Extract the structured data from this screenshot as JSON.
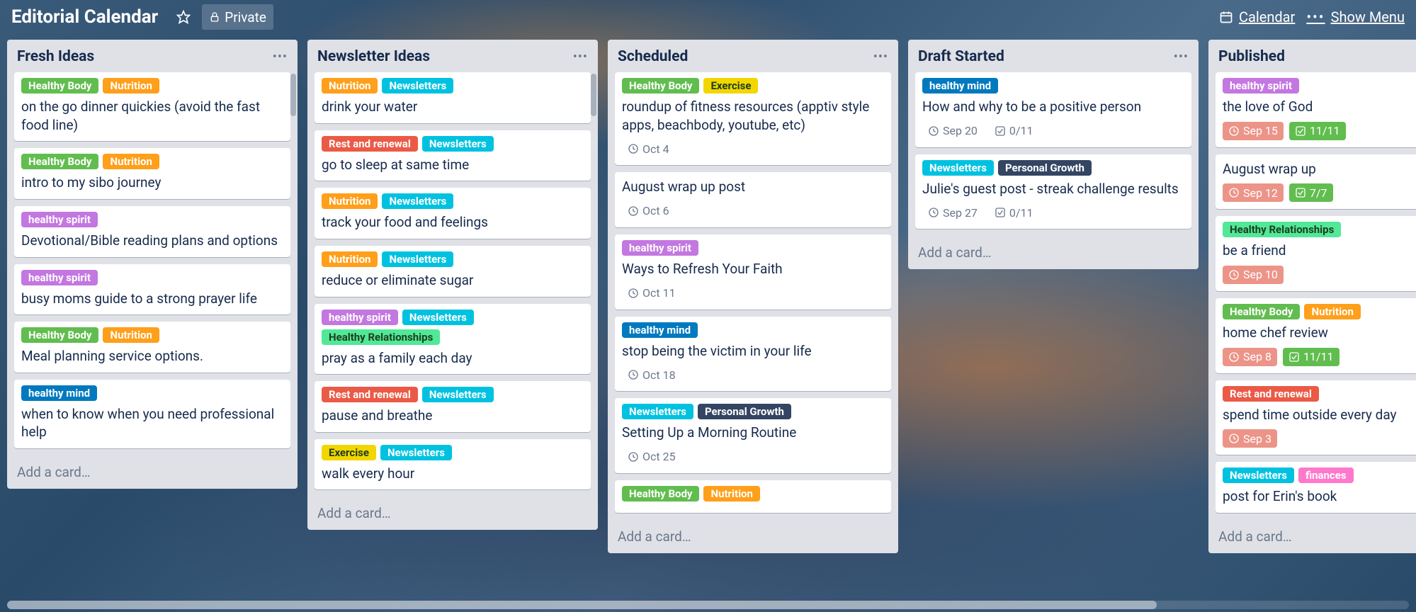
{
  "colors": {
    "green": "#61bd4f",
    "orange": "#ff9f1a",
    "yellow": "#f2d600",
    "purple": "#c377e0",
    "blue": "#0079bf",
    "aqua": "#00c2e0",
    "red": "#eb5a46",
    "lime": "#51e898",
    "pink": "#ff78cb",
    "black": "#344563",
    "date_past": "#ec9488",
    "checklist_done": "#61bd4f"
  },
  "header": {
    "title": "Editorial Calendar",
    "privacy": "Private",
    "calendar": "Calendar",
    "show_menu": "Show Menu"
  },
  "add_card_text": "Add a card…",
  "lists": [
    {
      "title": "Fresh Ideas",
      "show_menu": true,
      "scroll_hint": true,
      "cards": [
        {
          "labels": [
            {
              "text": "Healthy Body",
              "color": "green"
            },
            {
              "text": "Nutrition",
              "color": "orange"
            }
          ],
          "title": "on the go dinner quickies (avoid the fast food line)"
        },
        {
          "labels": [
            {
              "text": "Healthy Body",
              "color": "green"
            },
            {
              "text": "Nutrition",
              "color": "orange"
            }
          ],
          "title": "intro to my sibo journey"
        },
        {
          "labels": [
            {
              "text": "healthy spirit",
              "color": "purple"
            }
          ],
          "title": "Devotional/Bible reading plans and options"
        },
        {
          "labels": [
            {
              "text": "healthy spirit",
              "color": "purple"
            }
          ],
          "title": "busy moms guide to a strong prayer life"
        },
        {
          "labels": [
            {
              "text": "Healthy Body",
              "color": "green"
            },
            {
              "text": "Nutrition",
              "color": "orange"
            }
          ],
          "title": "Meal planning service options."
        },
        {
          "labels": [
            {
              "text": "healthy mind",
              "color": "blue"
            }
          ],
          "title": "when to know when you need professional help"
        }
      ]
    },
    {
      "title": "Newsletter Ideas",
      "show_menu": true,
      "scroll_hint": true,
      "cards": [
        {
          "labels": [
            {
              "text": "Nutrition",
              "color": "orange"
            },
            {
              "text": "Newsletters",
              "color": "aqua"
            }
          ],
          "title": "drink your water"
        },
        {
          "labels": [
            {
              "text": "Rest and renewal",
              "color": "red"
            },
            {
              "text": "Newsletters",
              "color": "aqua"
            }
          ],
          "title": "go to sleep at same time"
        },
        {
          "labels": [
            {
              "text": "Nutrition",
              "color": "orange"
            },
            {
              "text": "Newsletters",
              "color": "aqua"
            }
          ],
          "title": "track your food and feelings"
        },
        {
          "labels": [
            {
              "text": "Nutrition",
              "color": "orange"
            },
            {
              "text": "Newsletters",
              "color": "aqua"
            }
          ],
          "title": "reduce or eliminate sugar"
        },
        {
          "labels": [
            {
              "text": "healthy spirit",
              "color": "purple"
            },
            {
              "text": "Newsletters",
              "color": "aqua"
            },
            {
              "text": "Healthy Relationships",
              "color": "lime"
            }
          ],
          "title": "pray as a family each day"
        },
        {
          "labels": [
            {
              "text": "Rest and renewal",
              "color": "red"
            },
            {
              "text": "Newsletters",
              "color": "aqua"
            }
          ],
          "title": "pause and breathe"
        },
        {
          "labels": [
            {
              "text": "Exercise",
              "color": "yellow"
            },
            {
              "text": "Newsletters",
              "color": "aqua"
            }
          ],
          "title": "walk every hour"
        }
      ]
    },
    {
      "title": "Scheduled",
      "show_menu": true,
      "scroll_hint": false,
      "cards": [
        {
          "labels": [
            {
              "text": "Healthy Body",
              "color": "green"
            },
            {
              "text": "Exercise",
              "color": "yellow"
            }
          ],
          "title": "roundup of fitness resources (apptiv style apps, beachbody, youtube, etc)",
          "badges": [
            {
              "type": "date",
              "text": "Oct 4"
            }
          ]
        },
        {
          "labels": [],
          "title": "August wrap up post",
          "badges": [
            {
              "type": "date",
              "text": "Oct 6"
            }
          ]
        },
        {
          "labels": [
            {
              "text": "healthy spirit",
              "color": "purple"
            }
          ],
          "title": "Ways to Refresh Your Faith",
          "badges": [
            {
              "type": "date",
              "text": "Oct 11"
            }
          ]
        },
        {
          "labels": [
            {
              "text": "healthy mind",
              "color": "blue"
            }
          ],
          "title": "stop being the victim in your life",
          "badges": [
            {
              "type": "date",
              "text": "Oct 18"
            }
          ]
        },
        {
          "labels": [
            {
              "text": "Newsletters",
              "color": "aqua"
            },
            {
              "text": "Personal Growth",
              "color": "black"
            }
          ],
          "title": "Setting Up a Morning Routine",
          "badges": [
            {
              "type": "date",
              "text": "Oct 25"
            }
          ]
        },
        {
          "labels": [
            {
              "text": "Healthy Body",
              "color": "green"
            },
            {
              "text": "Nutrition",
              "color": "orange"
            }
          ],
          "title": ""
        }
      ]
    },
    {
      "title": "Draft Started",
      "show_menu": true,
      "scroll_hint": false,
      "cards": [
        {
          "labels": [
            {
              "text": "healthy mind",
              "color": "blue"
            }
          ],
          "title": "How and why to be a positive person",
          "badges": [
            {
              "type": "date",
              "text": "Sep 20"
            },
            {
              "type": "check",
              "text": "0/11"
            }
          ]
        },
        {
          "labels": [
            {
              "text": "Newsletters",
              "color": "aqua"
            },
            {
              "text": "Personal Growth",
              "color": "black"
            }
          ],
          "title": "Julie's guest post - streak challenge results",
          "badges": [
            {
              "type": "date",
              "text": "Sep 27"
            },
            {
              "type": "check",
              "text": "0/11"
            }
          ]
        }
      ]
    },
    {
      "title": "Published",
      "show_menu": false,
      "scroll_hint": false,
      "cards": [
        {
          "labels": [
            {
              "text": "healthy spirit",
              "color": "purple"
            }
          ],
          "title": "the love of God",
          "badges": [
            {
              "type": "date_past",
              "text": "Sep 15"
            },
            {
              "type": "check_done",
              "text": "11/11"
            }
          ]
        },
        {
          "labels": [],
          "title": "August wrap up",
          "badges": [
            {
              "type": "date_past",
              "text": "Sep 12"
            },
            {
              "type": "check_done",
              "text": "7/7"
            }
          ]
        },
        {
          "labels": [
            {
              "text": "Healthy Relationships",
              "color": "lime"
            }
          ],
          "title": "be a friend",
          "badges": [
            {
              "type": "date_past",
              "text": "Sep 10"
            }
          ]
        },
        {
          "labels": [
            {
              "text": "Healthy Body",
              "color": "green"
            },
            {
              "text": "Nutrition",
              "color": "orange"
            }
          ],
          "title": "home chef review",
          "badges": [
            {
              "type": "date_past",
              "text": "Sep 8"
            },
            {
              "type": "check_done",
              "text": "11/11"
            }
          ]
        },
        {
          "labels": [
            {
              "text": "Rest and renewal",
              "color": "red"
            }
          ],
          "title": "spend time outside every day",
          "badges": [
            {
              "type": "date_past",
              "text": "Sep 3"
            }
          ]
        },
        {
          "labels": [
            {
              "text": "Newsletters",
              "color": "aqua"
            },
            {
              "text": "finances",
              "color": "pink"
            }
          ],
          "title": "post for Erin's book"
        }
      ]
    }
  ]
}
